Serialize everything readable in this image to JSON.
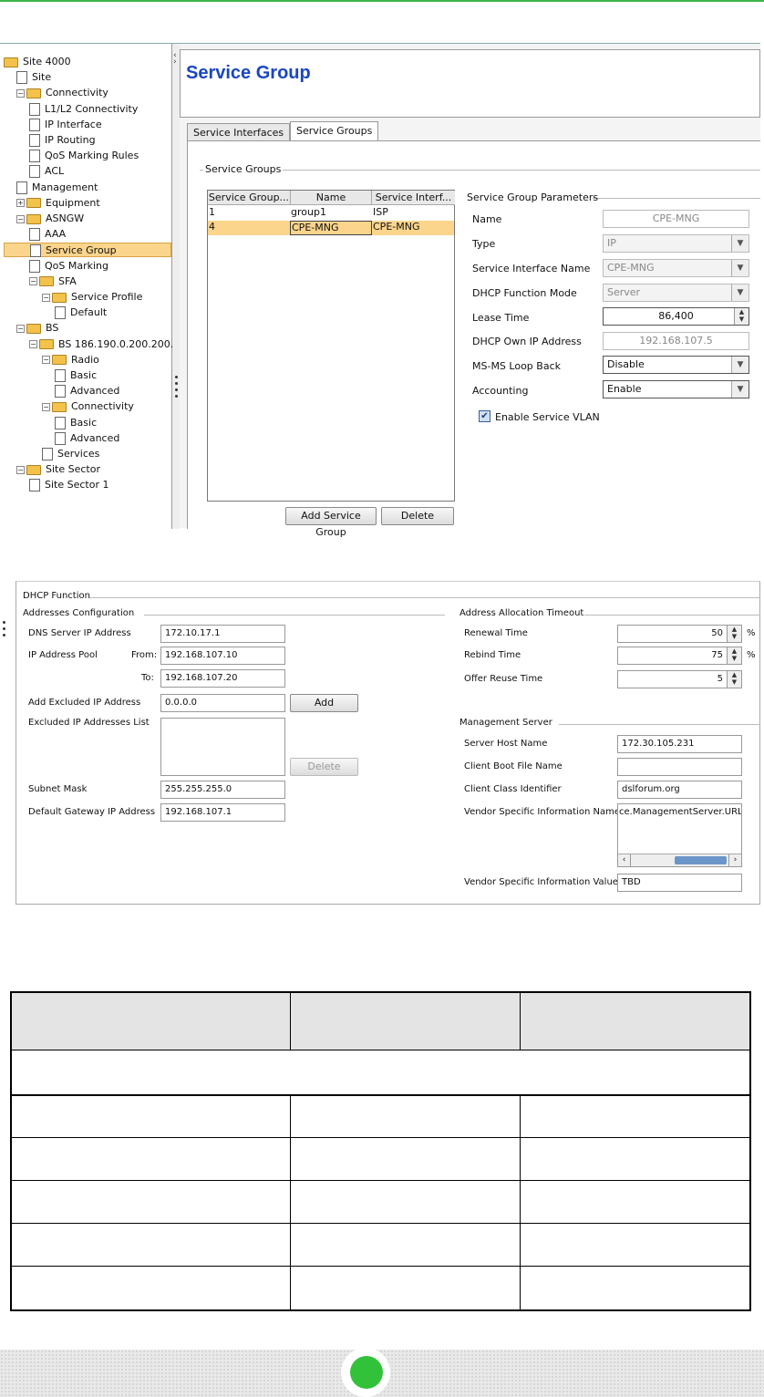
{
  "tree": {
    "items": [
      {
        "label": "Site 4000",
        "type": "folder-open"
      },
      {
        "label": "Site",
        "type": "file"
      },
      {
        "label": "Connectivity",
        "type": "folder-open"
      },
      {
        "label": "L1/L2 Connectivity",
        "type": "file"
      },
      {
        "label": "IP Interface",
        "type": "file"
      },
      {
        "label": "IP Routing",
        "type": "file"
      },
      {
        "label": "QoS Marking Rules",
        "type": "file"
      },
      {
        "label": "ACL",
        "type": "file"
      },
      {
        "label": "Management",
        "type": "file"
      },
      {
        "label": "Equipment",
        "type": "folder-closed"
      },
      {
        "label": "ASNGW",
        "type": "folder-open"
      },
      {
        "label": "AAA",
        "type": "file"
      },
      {
        "label": "Service Group",
        "type": "file",
        "selected": true
      },
      {
        "label": "QoS Marking",
        "type": "file"
      },
      {
        "label": "SFA",
        "type": "folder-open"
      },
      {
        "label": "Service Profile",
        "type": "folder-open"
      },
      {
        "label": "Default",
        "type": "file"
      },
      {
        "label": "BS",
        "type": "folder-open"
      },
      {
        "label": "BS 186.190.0.200.200.",
        "type": "folder-open"
      },
      {
        "label": "Radio",
        "type": "folder-open"
      },
      {
        "label": "Basic",
        "type": "file"
      },
      {
        "label": "Advanced",
        "type": "file"
      },
      {
        "label": "Connectivity",
        "type": "folder-open"
      },
      {
        "label": "Basic",
        "type": "file"
      },
      {
        "label": "Advanced",
        "type": "file"
      },
      {
        "label": "Services",
        "type": "file"
      },
      {
        "label": "Site Sector",
        "type": "folder-open"
      },
      {
        "label": "Site Sector 1",
        "type": "file"
      }
    ]
  },
  "header": {
    "title": "Service Group"
  },
  "tabs": [
    {
      "label": "Service Interfaces",
      "active": false
    },
    {
      "label": "Service Groups",
      "active": true
    }
  ],
  "service_groups": {
    "group_title": "Service Groups",
    "columns": [
      "Service Group...",
      "Name",
      "Service Interf..."
    ],
    "rows": [
      [
        "1",
        "group1",
        "ISP"
      ],
      [
        "4",
        "CPE-MNG",
        "CPE-MNG"
      ]
    ],
    "add_button": "Add Service Group",
    "delete_button": "Delete"
  },
  "params": {
    "title": "Service Group Parameters",
    "name_label": "Name",
    "name_value": "CPE-MNG",
    "type_label": "Type",
    "type_value": "IP",
    "sif_label": "Service Interface Name",
    "sif_value": "CPE-MNG",
    "dhcp_mode_label": "DHCP Function Mode",
    "dhcp_mode_value": "Server",
    "lease_label": "Lease Time",
    "lease_value": "86,400",
    "own_ip_label": "DHCP Own IP Address",
    "own_ip_value": "192.168.107.5",
    "loop_label": "MS-MS Loop Back",
    "loop_value": "Disable",
    "acct_label": "Accounting",
    "acct_value": "Enable",
    "vlan_label": "Enable Service VLAN",
    "vlan_checked": true
  },
  "dhcp": {
    "title": "DHCP Function",
    "addr_title": "Addresses Configuration",
    "dns_label": "DNS Server IP Address",
    "dns_value": "172.10.17.1",
    "pool_label": "IP Address Pool",
    "from_label": "From:",
    "from_value": "192.168.107.10",
    "to_label": "To:",
    "to_value": "192.168.107.20",
    "excl_label": "Add Excluded IP Address",
    "excl_value": "0.0.0.0",
    "add_button": "Add",
    "excl_list_label": "Excluded IP Addresses List",
    "delete_button": "Delete",
    "mask_label": "Subnet Mask",
    "mask_value": "255.255.255.0",
    "gw_label": "Default Gateway IP Address",
    "gw_value": "192.168.107.1",
    "timeout_title": "Address Allocation Timeout",
    "renewal_label": "Renewal Time",
    "renewal_value": "50",
    "rebind_label": "Rebind Time",
    "rebind_value": "75",
    "offer_label": "Offer Reuse Time",
    "offer_value": "5",
    "pct": "%",
    "mgmt_title": "Management Server",
    "host_label": "Server Host Name",
    "host_value": "172.30.105.231",
    "boot_label": "Client Boot File Name",
    "boot_value": "",
    "class_label": "Client Class Identifier",
    "class_value": "dslforum.org",
    "vsi_name_label": "Vendor Specific Information Name",
    "vsi_name_value": "ce.ManagementServer.URL",
    "vsi_value_label": "Vendor Specific Information Value",
    "vsi_value_value": "TBD"
  },
  "colors": {
    "accent_green": "#32c23a",
    "title_blue": "#1a46c0",
    "selection": "#fbd58c"
  }
}
